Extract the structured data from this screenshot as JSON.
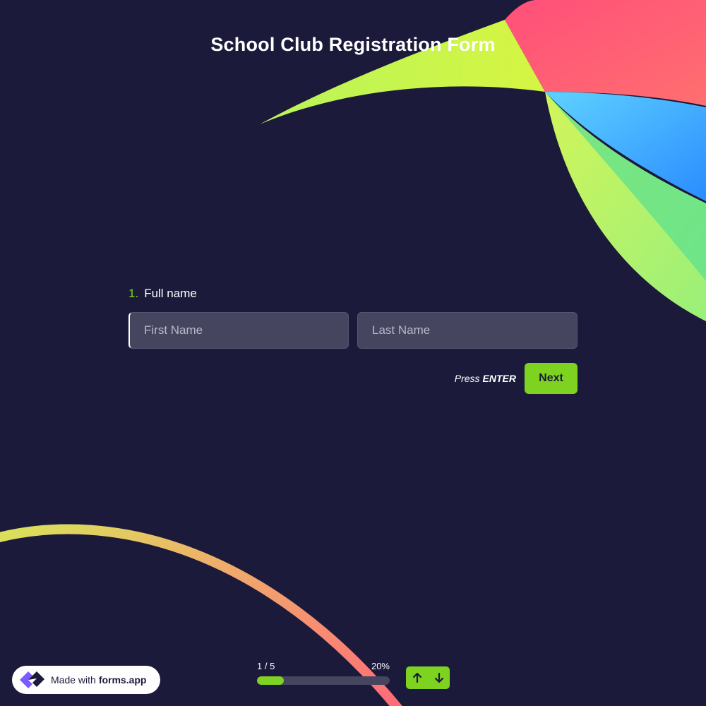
{
  "form": {
    "title": "School Club Registration Form"
  },
  "question": {
    "number": "1.",
    "label": "Full name",
    "first_name_placeholder": "First Name",
    "last_name_placeholder": "Last Name",
    "first_name_value": "",
    "last_name_value": ""
  },
  "actions": {
    "press_text": "Press",
    "press_key": "ENTER",
    "next_label": "Next"
  },
  "progress": {
    "step_text": "1 / 5",
    "percent_text": "20%",
    "fraction": 0.2
  },
  "navigation": {
    "up_icon": "arrow-up-icon",
    "down_icon": "arrow-down-icon"
  },
  "branding": {
    "made_with": "Made with",
    "brand": "forms.app",
    "logo_icon": "forms-app-logo"
  },
  "colors": {
    "background": "#1c1a3a",
    "accent": "#7ed321",
    "input_bg": "#45455f",
    "text": "#ffffff"
  }
}
